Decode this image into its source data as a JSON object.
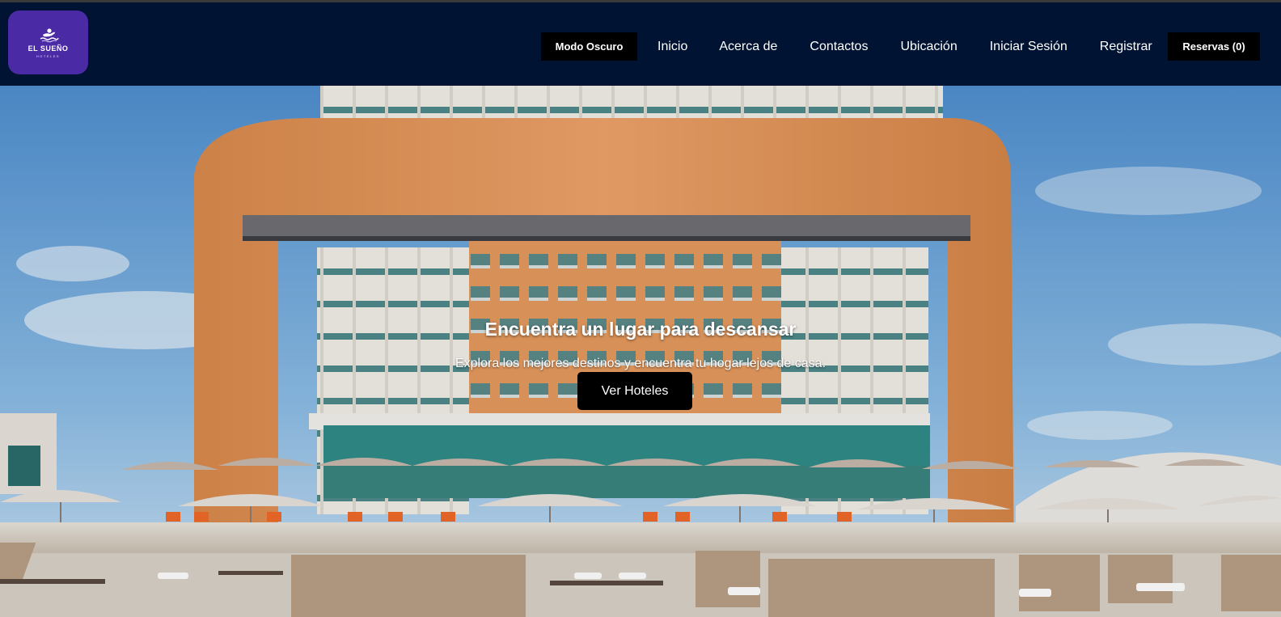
{
  "brand": {
    "name": "EL SUEÑO",
    "subtitle": "HOTELES",
    "logo_color": "#4b2aa6"
  },
  "navbar": {
    "background": "#011332",
    "mode_button": "Modo Oscuro",
    "links": [
      "Inicio",
      "Acerca de",
      "Contactos",
      "Ubicación",
      "Iniciar Sesión",
      "Registrar"
    ],
    "reservations_button": "Reservas (0)"
  },
  "hero": {
    "title": "Encuentra un lugar para descansar",
    "subtitle": "Explora los mejores destinos y encuentra tu hogar lejos de casa.",
    "cta": "Ver Hoteles"
  }
}
